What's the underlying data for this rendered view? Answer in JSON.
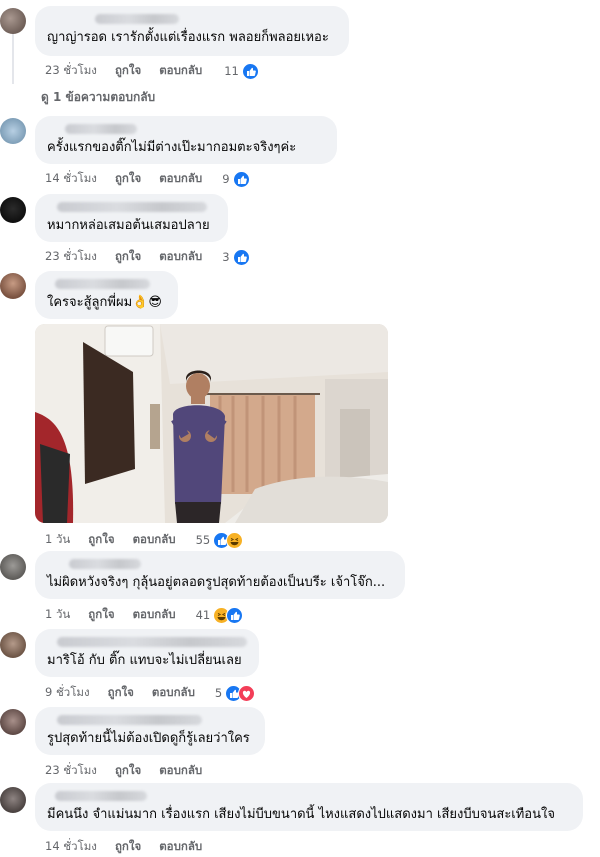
{
  "comments": [
    {
      "text": "ญาญ่ารอด เรารักตั้งแต่เรื่องแรก พลอยก็พลอยเหอะ",
      "time": "23 ชั่วโมง",
      "like": "ถูกใจ",
      "reply": "ตอบกลับ",
      "count": "11"
    },
    {
      "text": "ครั้งแรกของติ๊กไม่มีต่างเป๊ะมากอมตะจริงๆค่ะ",
      "time": "14 ชั่วโมง",
      "like": "ถูกใจ",
      "reply": "ตอบกลับ",
      "count": "9"
    },
    {
      "text": "หมากหล่อเสมอต้นเสมอปลาย",
      "time": "23 ชั่วโมง",
      "like": "ถูกใจ",
      "reply": "ตอบกลับ",
      "count": "3"
    },
    {
      "text": "ใครจะสู้ลูกพี่ผม👌😎",
      "time": "1 วัน",
      "like": "ถูกใจ",
      "reply": "ตอบกลับ",
      "count": "55"
    },
    {
      "text": "ไม่ผิดหวังจริงๆ กุลุ้นอยู่ตลอดรูปสุดท้ายต้องเป็นบรีะ เจ้าโจ๊ก...",
      "time": "1 วัน",
      "like": "ถูกใจ",
      "reply": "ตอบกลับ",
      "count": "41"
    },
    {
      "text": "มาริโอ้ กับ ติ๊ก แทบจะไม่เปลี่ยนเลย",
      "time": "9 ชั่วโมง",
      "like": "ถูกใจ",
      "reply": "ตอบกลับ",
      "count": "5"
    },
    {
      "text": "รูปสุดท้ายนี้ไม่ต้องเปิดดูก็รู้เลยว่าใคร",
      "time": "23 ชั่วโมง",
      "like": "ถูกใจ",
      "reply": "ตอบกลับ",
      "count": ""
    },
    {
      "text": "มีคนนึง จำแม่นมาก เรื่องแรก เสียงไม่บีบขนาดนี้ ไหงแสดงไปแสดงมา เสียงบีบจนสะเทือนใจ",
      "time": "14 ชั่วโมง",
      "like": "ถูกใจ",
      "reply": "ตอบกลับ",
      "count": ""
    }
  ],
  "view_replies": "ดู 1 ข้อความตอบกลับ",
  "colors": {
    "bubble": "#f0f2f5",
    "meta": "#65676b",
    "like_blue": "#1877f2",
    "haha": "#f7b125",
    "love": "#f33e58"
  }
}
